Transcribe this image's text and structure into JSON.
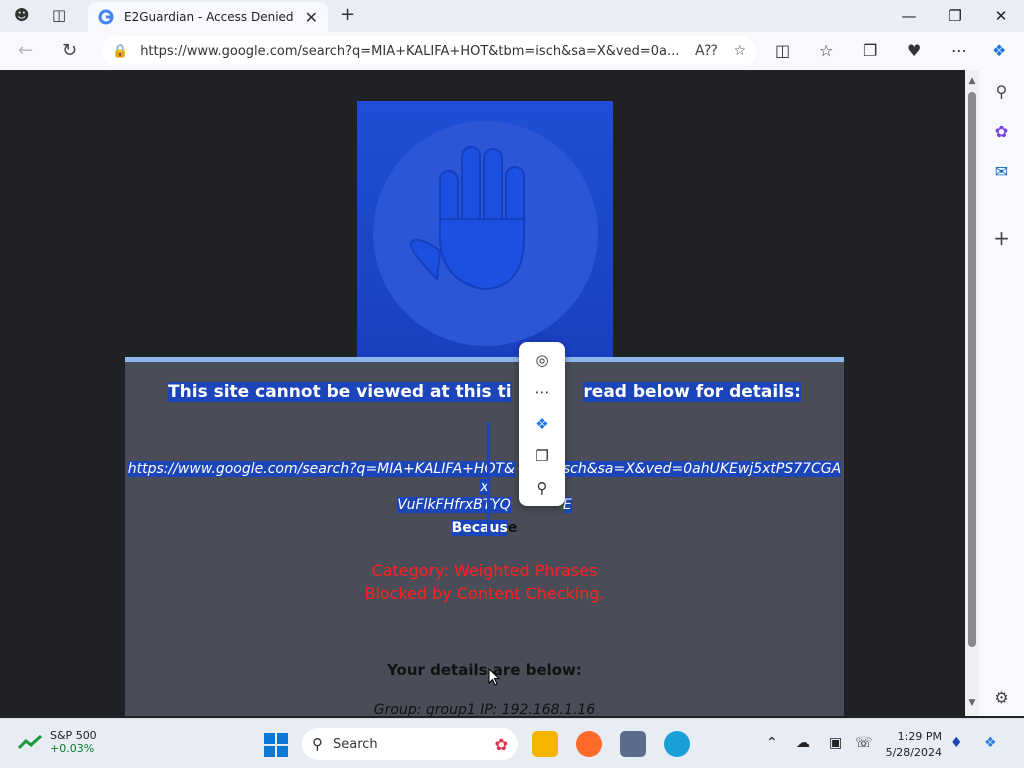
{
  "browser": {
    "tab_title": "E2Guardian - Access Denied",
    "url": "https://www.google.com/search?q=MIA+KALIFA+HOT&tbm=isch&sa=X&ved=0a..."
  },
  "page": {
    "headline_a": "This site cannot be viewed at this ti",
    "headline_b": "read below for details:",
    "blocked_url_1": "https://www.google.com/search?q=MIA+KALIFA+HOT&",
    "blocked_url_2": "isch&sa=X&ved=0ahUKEwj5xtPS77CGAx",
    "blocked_url_3": "VuFlkFHfrxBTYQ",
    "blocked_url_4": "E",
    "because_sel": "Becaus",
    "because_rest": "e",
    "category_line1": "Category: Weighted Phrases",
    "category_line2": "Blocked by Content Checking.",
    "details_heading": "Your details are below:",
    "group_info": "Group: group1   IP: 192.168.1.16"
  },
  "taskbar": {
    "stock_name": "S&P 500",
    "stock_change": "+0.03%",
    "search_label": "Search",
    "time": "1:29 PM",
    "date": "5/28/2024"
  },
  "colors": {
    "accent": "#1b45b8",
    "blocked_red": "#ff1f1f",
    "panel": "#4a4d57"
  }
}
